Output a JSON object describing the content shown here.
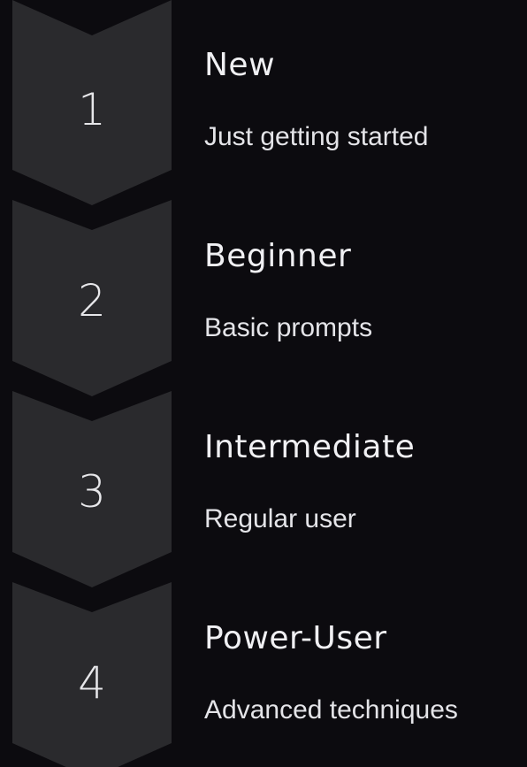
{
  "colors": {
    "background": "#0c0b0f",
    "chevron": "#2a2a2d",
    "text": "#f0f0f3"
  },
  "steps": [
    {
      "number": "1",
      "title": "New",
      "description": "Just getting started"
    },
    {
      "number": "2",
      "title": "Beginner",
      "description": "Basic prompts"
    },
    {
      "number": "3",
      "title": "Intermediate",
      "description": "Regular user"
    },
    {
      "number": "4",
      "title": "Power-User",
      "description": "Advanced techniques"
    }
  ]
}
